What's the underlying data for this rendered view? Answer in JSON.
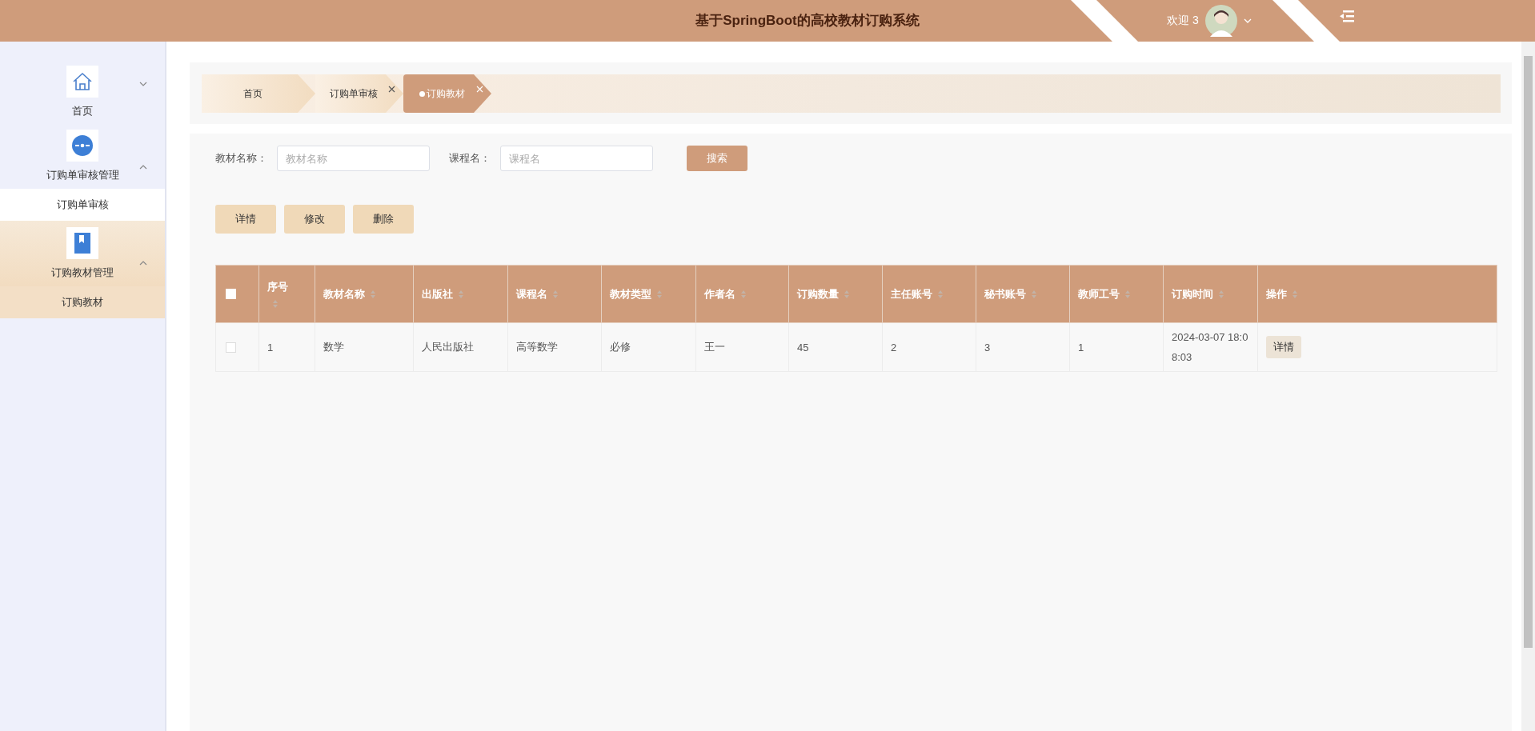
{
  "header": {
    "title": "基于SpringBoot的高校教材订购系统",
    "welcome": "欢迎 3"
  },
  "sidebar": {
    "items": [
      {
        "label": "首页",
        "expanded": false,
        "selected": false
      },
      {
        "label": "订购单审核管理",
        "expanded": true,
        "selected": false,
        "children": [
          {
            "label": "订购单审核",
            "selected": false
          }
        ]
      },
      {
        "label": "订购教材管理",
        "expanded": true,
        "selected": true,
        "children": [
          {
            "label": "订购教材",
            "selected": true
          }
        ]
      }
    ]
  },
  "tabs": [
    {
      "label": "首页",
      "closable": false,
      "selected": false
    },
    {
      "label": "订购单审核",
      "closable": true,
      "selected": false
    },
    {
      "label": "订购教材",
      "closable": true,
      "selected": true
    }
  ],
  "search": {
    "fields": [
      {
        "label": "教材名称：",
        "placeholder": "教材名称"
      },
      {
        "label": "课程名：",
        "placeholder": "课程名"
      }
    ],
    "button": "搜索"
  },
  "actions": [
    "详情",
    "修改",
    "删除"
  ],
  "table": {
    "select_all_checked": false,
    "columns": [
      {
        "label": "序号"
      },
      {
        "label": "教材名称"
      },
      {
        "label": "出版社"
      },
      {
        "label": "课程名"
      },
      {
        "label": "教材类型"
      },
      {
        "label": "作者名"
      },
      {
        "label": "订购数量"
      },
      {
        "label": "主任账号"
      },
      {
        "label": "秘书账号"
      },
      {
        "label": "教师工号"
      },
      {
        "label": "订购时间"
      },
      {
        "label": "操作"
      }
    ],
    "rows": [
      {
        "checked": false,
        "cells": [
          "1",
          "数学",
          "人民出版社",
          "高等数学",
          "必修",
          "王一",
          "45",
          "2",
          "3",
          "1",
          "2024-03-07 18:08:03"
        ],
        "action": "详情"
      }
    ]
  }
}
